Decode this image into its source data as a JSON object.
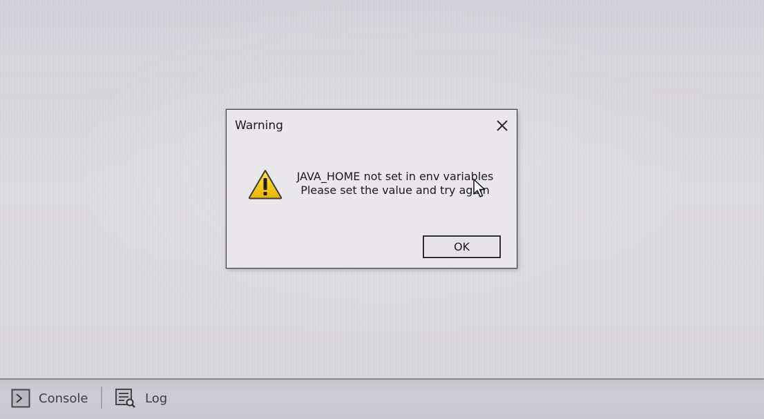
{
  "dialog": {
    "title": "Warning",
    "close_icon": "close-icon",
    "icon": "warning-icon",
    "message_line1": "JAVA_HOME not set in env variables",
    "message_line2": "Please set the value and try again",
    "ok_label": "OK"
  },
  "bottom_tabs": [
    {
      "label": "Console",
      "icon": "console-icon"
    },
    {
      "label": "Log",
      "icon": "log-icon"
    }
  ],
  "colors": {
    "warning_yellow": "#f2c500",
    "warning_outline": "#2a2a2a"
  }
}
